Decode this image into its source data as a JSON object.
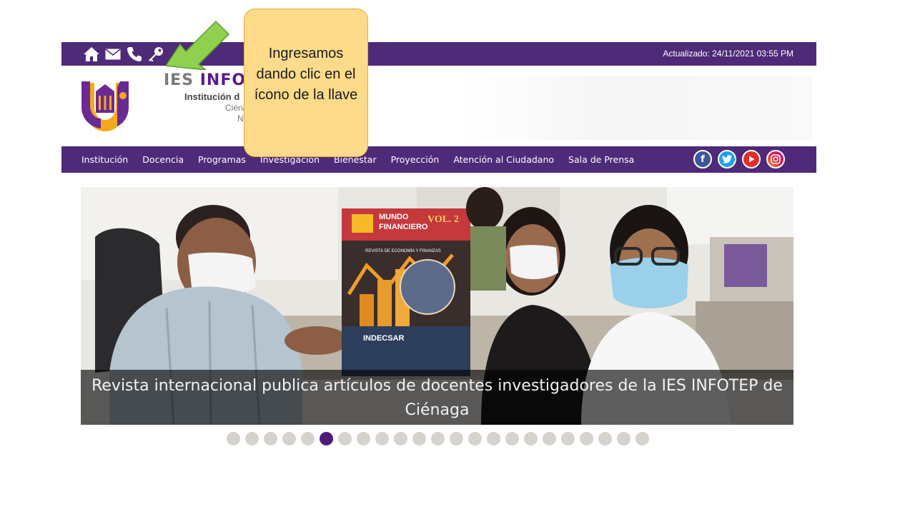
{
  "topbar": {
    "icons": [
      "home-icon",
      "mail-icon",
      "phone-icon",
      "key-icon"
    ],
    "updated": "Actualizado: 24/11/2021 03:55 PM"
  },
  "header": {
    "brand_part1": "IES ",
    "brand_part2": "INFO",
    "subtitle": "Institución d",
    "line2": "Ciéna",
    "line3": "N"
  },
  "nav": {
    "items": [
      "Institución",
      "Docencia",
      "Programas",
      "Investigación",
      "Bienestar",
      "Proyección",
      "Atención al Ciudadano",
      "Sala de Prensa"
    ]
  },
  "social": {
    "facebook": "f",
    "twitter": "twitter-icon",
    "youtube": "youtube-icon",
    "instagram": "instagram-icon"
  },
  "slider": {
    "caption": "Revista internacional publica artículos de docentes investigadores de la IES INFOTEP de Ciénaga",
    "magazine_title_1": "MUNDO",
    "magazine_title_2": "FINANCIERO",
    "magazine_vol": "VOL. 2",
    "magazine_sub": "REVISTA DE ECONOMÍA Y FINANZAS",
    "magazine_publisher": "INDECSAR",
    "slide_count": 23,
    "active_index": 5
  },
  "annotation": {
    "text": "Ingresamos dando clic en el ícono de la llave"
  },
  "colors": {
    "brand_purple": "#4e2a78",
    "callout_fill": "#fedb8a",
    "arrow_green": "#8fd14f"
  }
}
